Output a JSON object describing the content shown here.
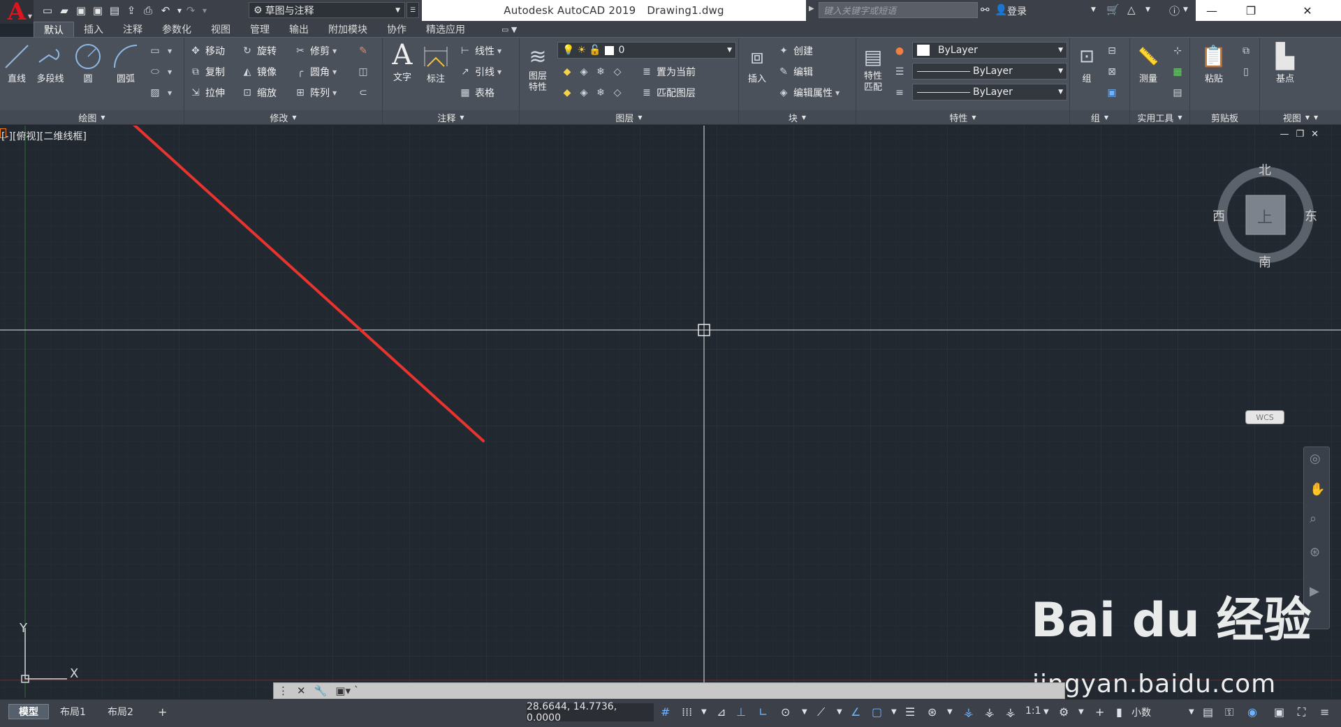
{
  "app": {
    "title": "Autodesk AutoCAD 2019",
    "document": "Drawing1.dwg",
    "workspace": "草图与注释",
    "search_placeholder": "键入关键字或短语",
    "login": "登录"
  },
  "tabs": [
    "默认",
    "插入",
    "注释",
    "参数化",
    "视图",
    "管理",
    "输出",
    "附加模块",
    "协作",
    "精选应用"
  ],
  "active_tab": "默认",
  "ribbon": {
    "draw": {
      "title": "绘图",
      "line": "直线",
      "polyline": "多段线",
      "circle": "圆",
      "arc": "圆弧"
    },
    "modify": {
      "title": "修改",
      "move": "移动",
      "rotate": "旋转",
      "trim": "修剪",
      "copy": "复制",
      "mirror": "镜像",
      "fillet": "圆角",
      "stretch": "拉伸",
      "scale": "缩放",
      "array": "阵列"
    },
    "annotation": {
      "title": "注释",
      "text": "文字",
      "dimension": "标注",
      "linear": "线性",
      "leader": "引线",
      "table": "表格"
    },
    "layers": {
      "title": "图层",
      "layer_properties": "图层特性",
      "layer_value": "0",
      "make_current": "置为当前",
      "match_layer": "匹配图层"
    },
    "block": {
      "title": "块",
      "insert": "插入",
      "create": "创建",
      "edit": "编辑",
      "edit_attributes": "编辑属性"
    },
    "properties": {
      "title": "特性",
      "match_properties": "特性匹配",
      "color": "ByLayer",
      "linetype": "ByLayer",
      "lineweight": "ByLayer"
    },
    "groups": {
      "title": "组",
      "group": "组"
    },
    "utilities": {
      "title": "实用工具",
      "measure": "测量"
    },
    "clipboard": {
      "title": "剪贴板",
      "paste": "粘贴"
    },
    "view": {
      "title": "视图",
      "base": "基点"
    }
  },
  "viewport": {
    "label": "[-][俯视][二维线框]",
    "viewcube": {
      "north": "北",
      "south": "南",
      "east": "东",
      "west": "西",
      "top": "上"
    },
    "wcs": "WCS",
    "ucs_x": "X",
    "ucs_y": "Y"
  },
  "layouts": [
    "模型",
    "布局1",
    "布局2"
  ],
  "status": {
    "coords": "28.6644, 14.7736, 0.0000",
    "scale": "1:1",
    "units": "小数"
  },
  "watermark": {
    "brand": "Bai du 经验",
    "url": "jingyan.baidu.com"
  },
  "colors": {
    "canvas": "#212830",
    "ribbon": "#4b515b",
    "annotation_arrow": "#e8332f",
    "accent_red": "#e0141e"
  }
}
